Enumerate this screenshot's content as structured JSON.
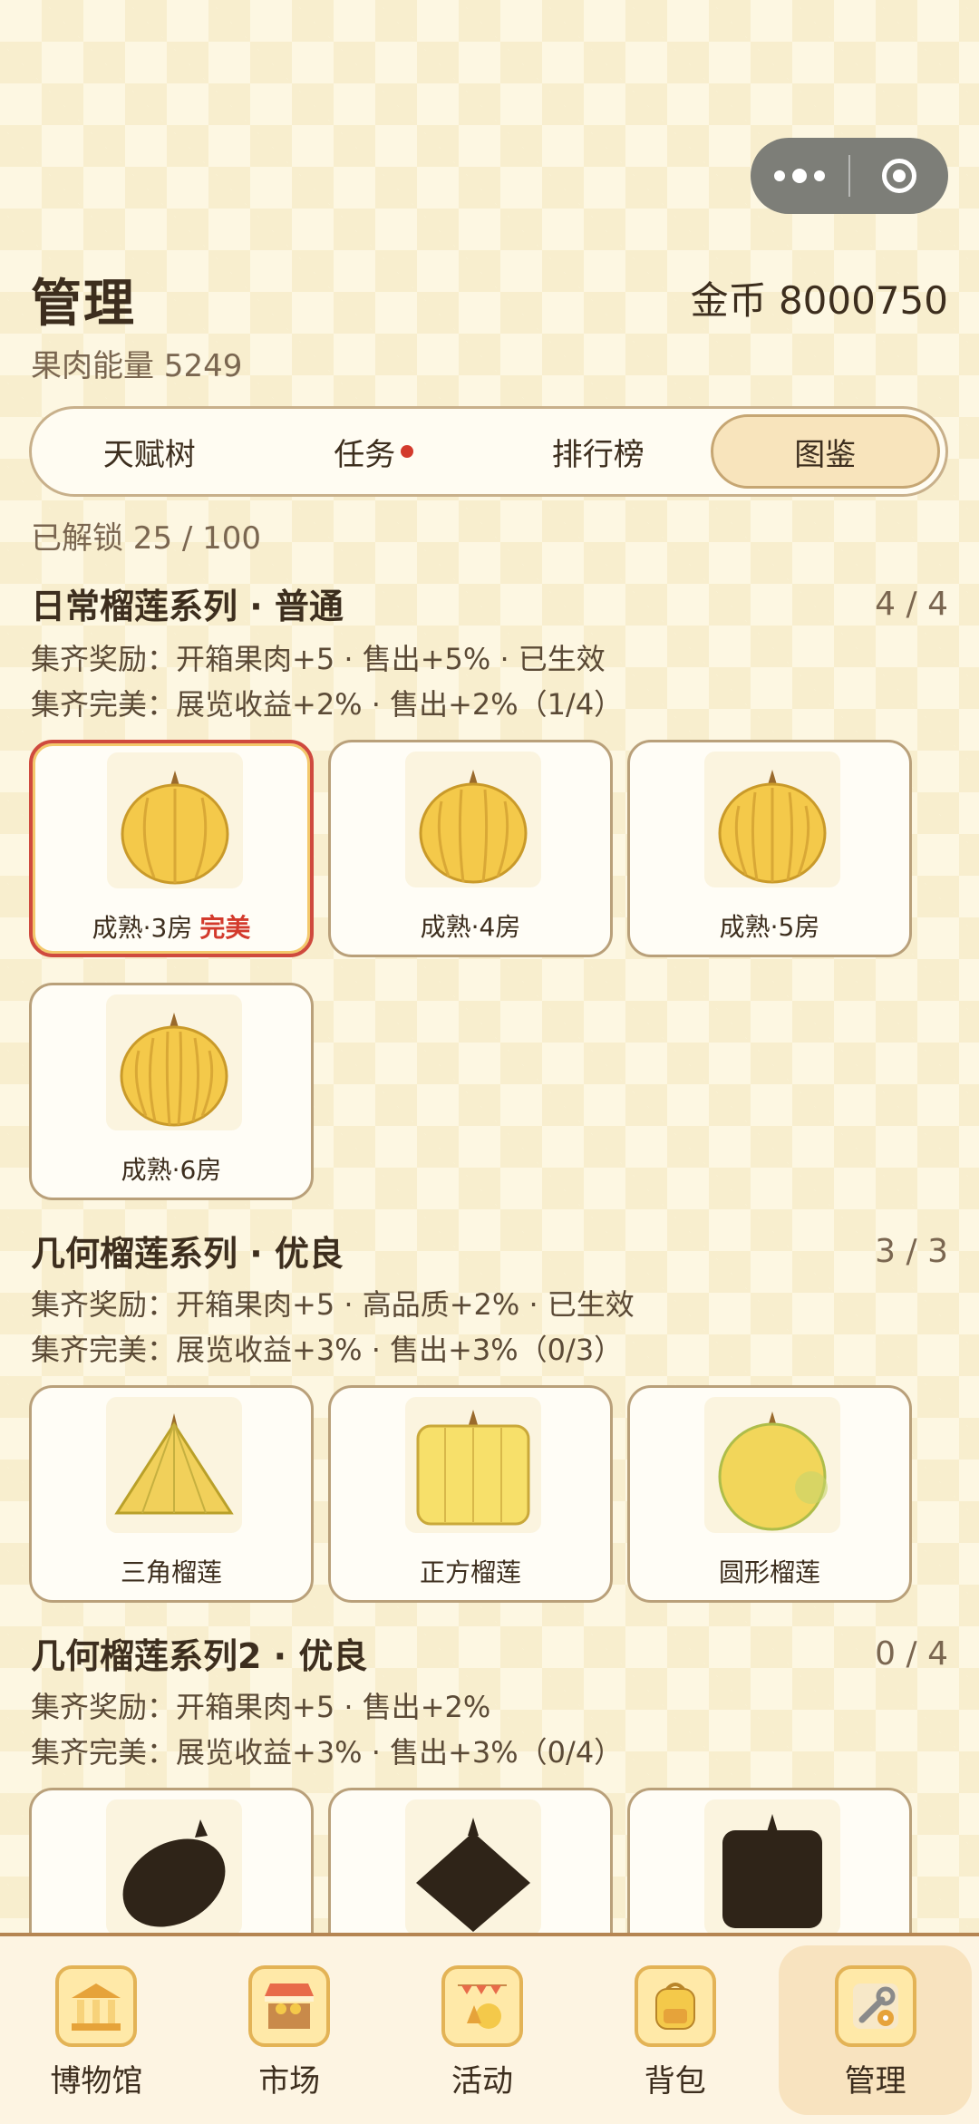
{
  "page": {
    "title": "管理",
    "coins": "金币 8000750",
    "energy": "果肉能量 5249",
    "unlocked": "已解锁 25 / 100"
  },
  "tabs": [
    {
      "label": "天赋树",
      "active": false,
      "badge": false
    },
    {
      "label": "任务",
      "active": false,
      "badge": true
    },
    {
      "label": "排行榜",
      "active": false,
      "badge": false
    },
    {
      "label": "图鉴",
      "active": true,
      "badge": false
    }
  ],
  "series": [
    {
      "title": "日常榴莲系列 · 普通",
      "count": "4 / 4",
      "reward": "集齐奖励：开箱果肉+5 · 售出+5% · 已生效",
      "perfect": "集齐完美：展览收益+2% · 售出+2%（1/4）",
      "cards": [
        {
          "label": "成熟·3房",
          "tag": "完美",
          "selected": true
        },
        {
          "label": "成熟·4房",
          "tag": "",
          "selected": false
        },
        {
          "label": "成熟·5房",
          "tag": "",
          "selected": false
        },
        {
          "label": "成熟·6房",
          "tag": "",
          "selected": false
        }
      ]
    },
    {
      "title": "几何榴莲系列 · 优良",
      "count": "3 / 3",
      "reward": "集齐奖励：开箱果肉+5 · 高品质+2% · 已生效",
      "perfect": "集齐完美：展览收益+3% · 售出+3%（0/3）",
      "cards": [
        {
          "label": "三角榴莲"
        },
        {
          "label": "正方榴莲"
        },
        {
          "label": "圆形榴莲"
        }
      ]
    },
    {
      "title": "几何榴莲系列2 · 优良",
      "count": "0 / 4",
      "reward": "集齐奖励：开箱果肉+5 · 售出+2%",
      "perfect": "集齐完美：展览收益+3% · 售出+3%（0/4）"
    }
  ],
  "nav": [
    {
      "label": "博物馆",
      "icon": "museum-icon"
    },
    {
      "label": "市场",
      "icon": "market-icon"
    },
    {
      "label": "活动",
      "icon": "event-icon"
    },
    {
      "label": "背包",
      "icon": "backpack-icon"
    },
    {
      "label": "管理",
      "icon": "manage-icon",
      "active": true
    }
  ],
  "colors": {
    "accent_red": "#d33a2c",
    "border_brown": "#b9a07a",
    "durian_yellow": "#f4c94a",
    "background": "#fdf7e2"
  }
}
